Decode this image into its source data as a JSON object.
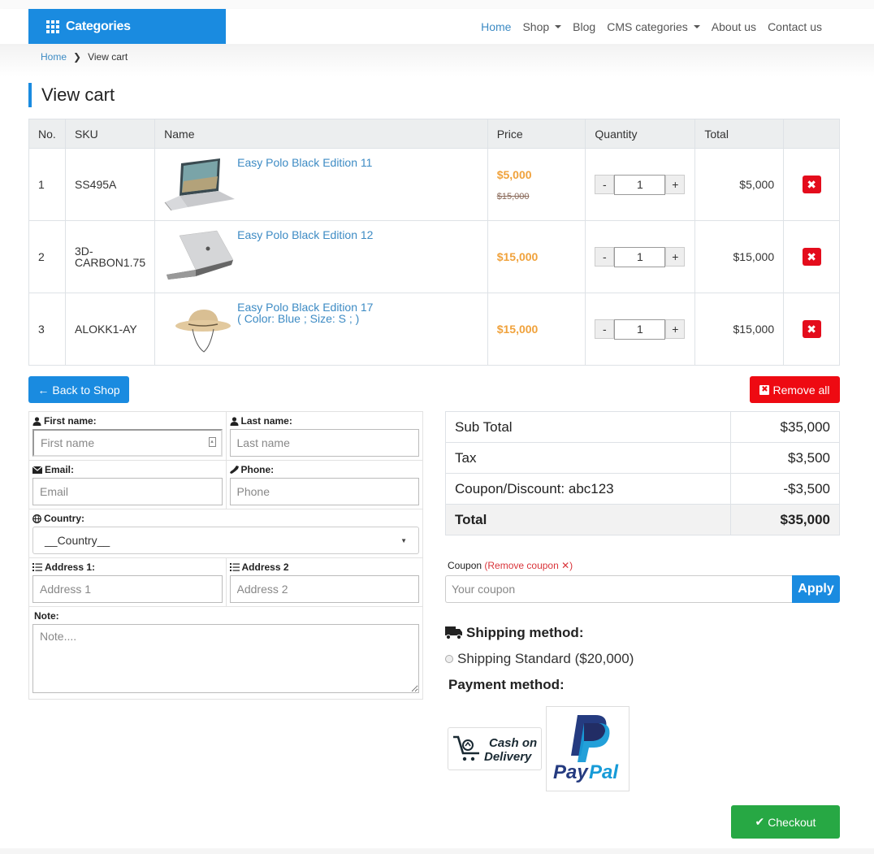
{
  "header": {
    "categories_label": "Categories",
    "nav": [
      {
        "label": "Home",
        "active": true,
        "dropdown": false
      },
      {
        "label": "Shop",
        "active": false,
        "dropdown": true
      },
      {
        "label": "Blog",
        "active": false,
        "dropdown": false
      },
      {
        "label": "CMS categories",
        "active": false,
        "dropdown": true
      },
      {
        "label": "About us",
        "active": false,
        "dropdown": false
      },
      {
        "label": "Contact us",
        "active": false,
        "dropdown": false
      }
    ]
  },
  "breadcrumb": {
    "home": "Home",
    "separator": ">",
    "current": "View cart"
  },
  "page_title": "View cart",
  "cart": {
    "columns": [
      "No.",
      "SKU",
      "Name",
      "Price",
      "Quantity",
      "Total",
      ""
    ],
    "rows": [
      {
        "no": "1",
        "sku": "SS495A",
        "name": "Easy Polo Black Edition 11",
        "options": "",
        "image": "laptop-open",
        "price": "$5,000",
        "old_price": "$15,000",
        "quantity": "1",
        "total": "$5,000"
      },
      {
        "no": "2",
        "sku": "3D-\nCARBON1.75",
        "name": "Easy Polo Black Edition 12",
        "options": "",
        "image": "laptop-closed",
        "price": "$15,000",
        "old_price": "",
        "quantity": "1",
        "total": "$15,000"
      },
      {
        "no": "3",
        "sku": "ALOKK1-AY",
        "name": "Easy Polo Black Edition 17",
        "options": "( Color: Blue ; Size: S ; )",
        "image": "sun-hat",
        "price": "$15,000",
        "old_price": "",
        "quantity": "1",
        "total": "$15,000"
      }
    ],
    "qty_minus": "-",
    "qty_plus": "+",
    "delete_icon": "✖"
  },
  "actions": {
    "back_to_shop": "Back to Shop",
    "remove_all": "Remove all"
  },
  "form": {
    "first_name": {
      "label": "First name:",
      "placeholder": "First name",
      "value": ""
    },
    "last_name": {
      "label": "Last name:",
      "placeholder": "Last name",
      "value": ""
    },
    "email": {
      "label": "Email:",
      "placeholder": "Email",
      "value": ""
    },
    "phone": {
      "label": "Phone:",
      "placeholder": "Phone",
      "value": ""
    },
    "country": {
      "label": "Country:",
      "selected": "__Country__"
    },
    "address1": {
      "label": "Address 1:",
      "placeholder": "Address 1",
      "value": ""
    },
    "address2": {
      "label": "Address 2",
      "placeholder": "Address 2",
      "value": ""
    },
    "note": {
      "label": "Note:",
      "placeholder": "Note....",
      "value": ""
    }
  },
  "summary": {
    "rows": [
      {
        "label": "Sub Total",
        "value": "$35,000"
      },
      {
        "label": "Tax",
        "value": "$3,500"
      },
      {
        "label": "Coupon/Discount: abc123",
        "value": "-$3,500"
      },
      {
        "label": "Total",
        "value": "$35,000"
      }
    ]
  },
  "coupon": {
    "label": "Coupon",
    "remove_label": "(Remove coupon ✕)",
    "placeholder": "Your coupon",
    "value": "",
    "apply_label": "Apply"
  },
  "shipping": {
    "title": "Shipping method:",
    "options": [
      {
        "label": "Shipping Standard ($20,000)",
        "selected": false
      }
    ]
  },
  "payment": {
    "title": "Payment method:",
    "methods": [
      {
        "name": "cash-on-delivery",
        "line1": "Cash on",
        "line2": "Delivery"
      },
      {
        "name": "paypal",
        "label_dark": "Pay",
        "label_light": "Pal"
      }
    ]
  },
  "checkout_label": "Checkout",
  "colors": {
    "primary": "#1a8be0",
    "danger": "#ee0a12",
    "success": "#27a844",
    "price": "#f0a23c",
    "link": "#3d8bc4"
  }
}
